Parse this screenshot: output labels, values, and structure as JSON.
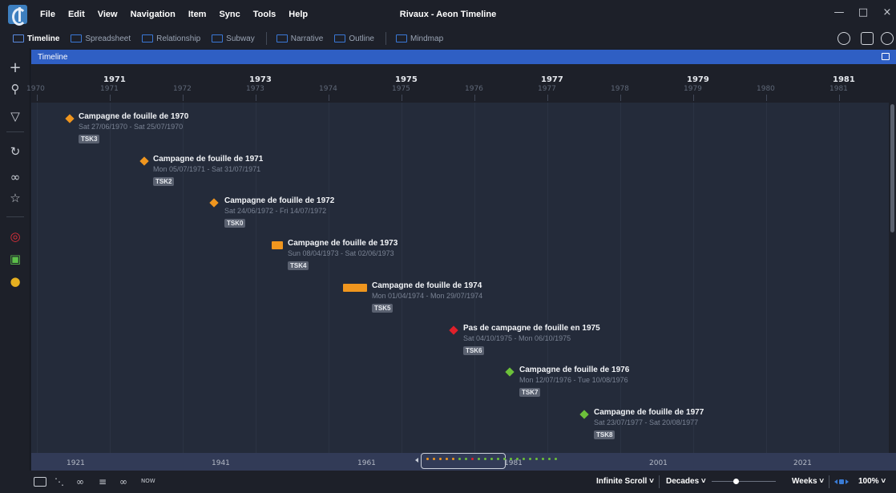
{
  "window": {
    "title": "Rivaux - Aeon Timeline"
  },
  "menu": [
    "File",
    "Edit",
    "View",
    "Navigation",
    "Item",
    "Sync",
    "Tools",
    "Help"
  ],
  "view_tabs": [
    {
      "label": "Timeline",
      "icon": "timeline-icon",
      "active": true
    },
    {
      "label": "Spreadsheet",
      "icon": "spreadsheet-icon"
    },
    {
      "label": "Relationship",
      "icon": "relationship-icon"
    },
    {
      "label": "Subway",
      "icon": "subway-icon"
    },
    {
      "label": "Narrative",
      "icon": "narrative-icon"
    },
    {
      "label": "Outline",
      "icon": "outline-icon"
    },
    {
      "label": "Mindmap",
      "icon": "mindmap-icon"
    }
  ],
  "timeline_panel": {
    "label": "Timeline"
  },
  "ruler": {
    "major": [
      "1971",
      "1973",
      "1975",
      "1977",
      "1979",
      "1981"
    ],
    "minor": [
      "1970",
      "1971",
      "1972",
      "1973",
      "1974",
      "1975",
      "1976",
      "1977",
      "1978",
      "1979",
      "1980",
      "1981"
    ]
  },
  "events": [
    {
      "title": "Campagne de fouille de 1970",
      "dates": "Sat 27/06/1970 - Sat 25/07/1970",
      "tag": "TSK3",
      "color": "#f0961e",
      "shape": "diamond"
    },
    {
      "title": "Campagne de fouille de 1971",
      "dates": "Mon 05/07/1971 - Sat 31/07/1971",
      "tag": "TSK2",
      "color": "#f0961e",
      "shape": "diamond"
    },
    {
      "title": "Campagne de fouille de 1972",
      "dates": "Sat 24/06/1972 - Fri 14/07/1972",
      "tag": "TSK0",
      "color": "#f0961e",
      "shape": "diamond"
    },
    {
      "title": "Campagne de fouille de 1973",
      "dates": "Sun 08/04/1973 - Sat 02/06/1973",
      "tag": "TSK4",
      "color": "#f0961e",
      "shape": "bar"
    },
    {
      "title": "Campagne de fouille de 1974",
      "dates": "Mon 01/04/1974 - Mon 29/07/1974",
      "tag": "TSK5",
      "color": "#f0961e",
      "shape": "bar"
    },
    {
      "title": "Pas de campagne de fouille en 1975",
      "dates": "Sat 04/10/1975 - Mon 06/10/1975",
      "tag": "TSK6",
      "color": "#e0202a",
      "shape": "diamond"
    },
    {
      "title": "Campagne de fouille de 1976",
      "dates": "Mon 12/07/1976 - Tue 10/08/1976",
      "tag": "TSK7",
      "color": "#6cc13a",
      "shape": "diamond"
    },
    {
      "title": "Campagne de fouille de 1977",
      "dates": "Sat 23/07/1977 - Sat 20/08/1977",
      "tag": "TSK8",
      "color": "#6cc13a",
      "shape": "diamond"
    }
  ],
  "overview": {
    "years": [
      "1921",
      "1941",
      "1961",
      "1981",
      "2001",
      "2021"
    ]
  },
  "bottom": {
    "now_label": "NOW",
    "scroll_mode": "Infinite Scroll",
    "scale": "Decades",
    "unit": "Weeks",
    "zoom": "100%"
  },
  "colors": {
    "accent": "#2f5fc4",
    "orange": "#f0961e",
    "red": "#e0202a",
    "green": "#6cc13a"
  }
}
